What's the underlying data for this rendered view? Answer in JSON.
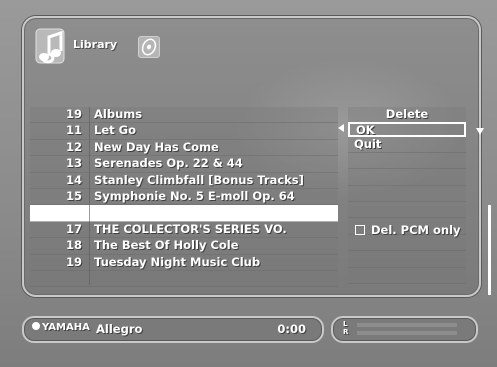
{
  "header": {
    "title": "Library",
    "icons": [
      "music-note-icon",
      "disc-icon"
    ]
  },
  "track_list": [
    {
      "num": "19",
      "title": "Albums"
    },
    {
      "num": "11",
      "title": "Let Go"
    },
    {
      "num": "12",
      "title": "New Day Has Come"
    },
    {
      "num": "13",
      "title": "Serenades Op. 22 & 44"
    },
    {
      "num": "14",
      "title": "Stanley Climbfall [Bonus Tracks]"
    },
    {
      "num": "15",
      "title": "Symphonie No. 5 E-moll Op. 64"
    },
    {
      "num": "",
      "title": ""
    },
    {
      "num": "17",
      "title": "THE COLLECTOR'S SERIES  VO."
    },
    {
      "num": "18",
      "title": "The Best Of Holly Cole"
    },
    {
      "num": "19",
      "title": "Tuesday Night Music Club"
    }
  ],
  "menu": {
    "header": "Delete",
    "items": [
      "OK",
      "Quit"
    ],
    "focused_index": 0
  },
  "option": {
    "label": "Del. PCM only",
    "checked": false
  },
  "status": {
    "brand": "YAMAHA",
    "track": "Allegro",
    "time": "0:00",
    "level_label_top": "L",
    "level_label_bottom": "R"
  },
  "colors": {
    "background": "#8f8f8f",
    "text": "#ffffff",
    "selection": "#ffffff"
  }
}
